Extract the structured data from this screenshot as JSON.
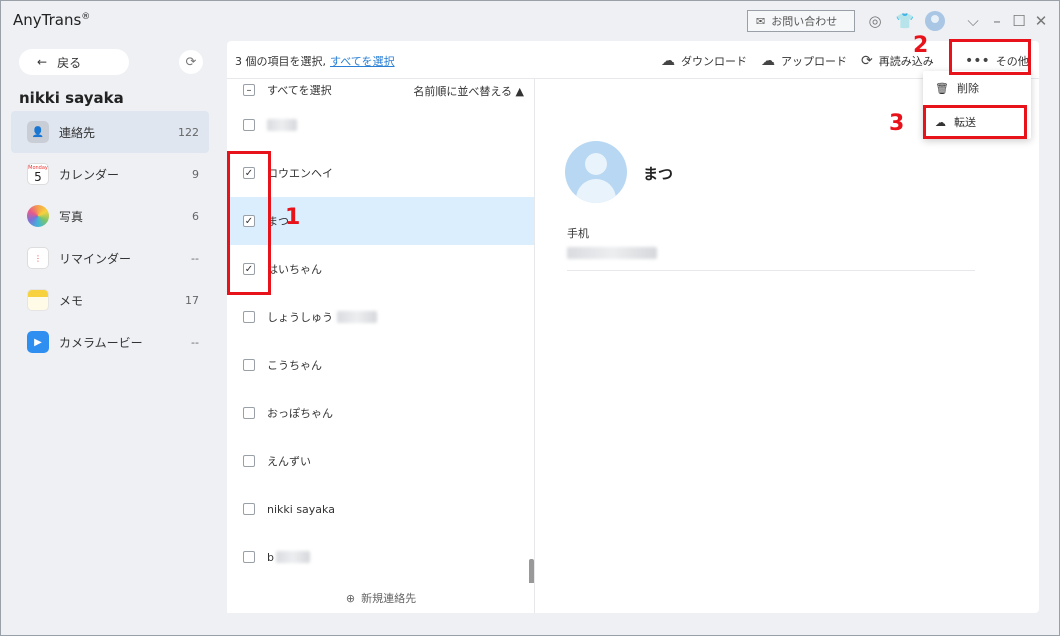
{
  "app": {
    "title": "AnyTrans",
    "reg": "®"
  },
  "titlebar": {
    "contact_label": "お問い合わせ",
    "icons": [
      "mail-icon",
      "search-circle-icon",
      "shirt-icon",
      "avatar",
      "chevron-down-icon",
      "minimize-icon",
      "maximize-icon",
      "close-icon"
    ]
  },
  "sidebar": {
    "back_label": "戻る",
    "device_name": "nikki sayaka",
    "items": [
      {
        "label": "連絡先",
        "count": "122",
        "icon": "contacts-icon",
        "color": "#c9ced6"
      },
      {
        "label": "カレンダー",
        "count": "9",
        "icon": "calendar-icon",
        "day": "5",
        "weekday": "Monday",
        "color": "#ffffff"
      },
      {
        "label": "写真",
        "count": "6",
        "icon": "photos-icon",
        "color": "#f4a14a"
      },
      {
        "label": "リマインダー",
        "count": "--",
        "icon": "reminders-icon",
        "color": "#ffffff"
      },
      {
        "label": "メモ",
        "count": "17",
        "icon": "notes-icon",
        "color": "#f7d23e"
      },
      {
        "label": "カメラムービー",
        "count": "--",
        "icon": "camera-movie-icon",
        "color": "#2f8ff0"
      }
    ]
  },
  "toolbar": {
    "status_prefix": "3 個の項目を選択,",
    "select_all_link": "すべてを選択",
    "download": "ダウンロード",
    "upload": "アップロード",
    "reload": "再読み込み",
    "more": "その他"
  },
  "list": {
    "header_select_all": "すべてを選択",
    "sort_label": "名前順に並べ替える ▲",
    "rows": [
      {
        "name": "",
        "checked": false,
        "blurred": true
      },
      {
        "name": "ロウエンヘイ",
        "checked": true
      },
      {
        "name": "まつ",
        "checked": true,
        "selected": true
      },
      {
        "name": "はいちゃん",
        "checked": true
      },
      {
        "name": "しょうしゅう",
        "checked": false,
        "blurred_suffix": true
      },
      {
        "name": "こうちゃん",
        "checked": false
      },
      {
        "name": "おっぽちゃん",
        "checked": false
      },
      {
        "name": "えんずい",
        "checked": false
      },
      {
        "name": "nikki sayaka",
        "checked": false
      },
      {
        "name": "b",
        "checked": false,
        "blurred_suffix": true
      }
    ],
    "new_contact": "新規連絡先"
  },
  "detail": {
    "name": "まつ",
    "field_label": "手机"
  },
  "menu": {
    "items": [
      {
        "label": "削除",
        "icon": "trash-icon"
      },
      {
        "label": "転送",
        "icon": "cloud-icon"
      }
    ]
  },
  "annotations": {
    "n1": "1",
    "n2": "2",
    "n3": "3",
    "color": "#e8131a"
  }
}
